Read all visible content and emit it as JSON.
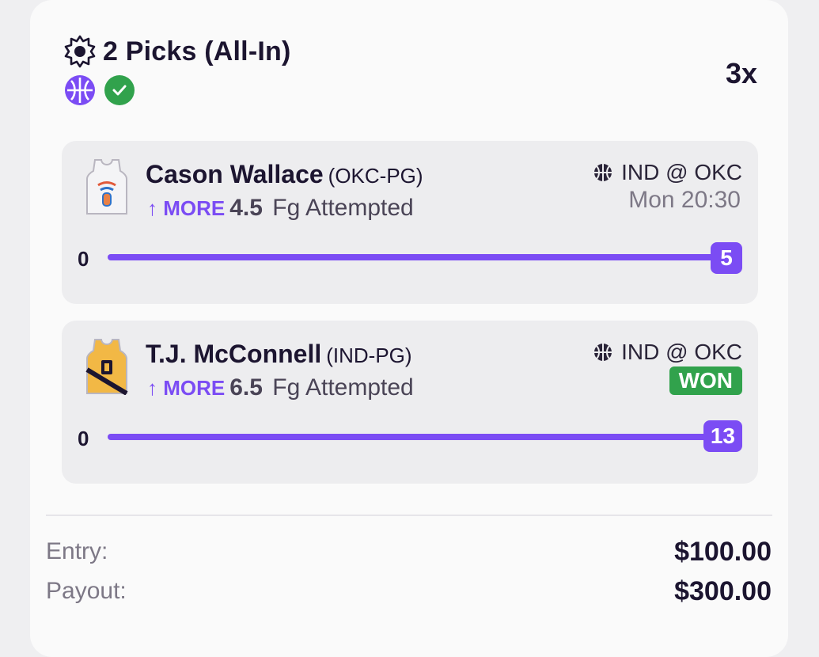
{
  "header": {
    "title": "2 Picks (All-In)",
    "multiplier": "3x",
    "icons": [
      "gear-icon",
      "basketball-icon",
      "check-icon"
    ],
    "accent_color": "#7b4cf4",
    "success_color": "#31a24c"
  },
  "picks": [
    {
      "player_name": "Cason Wallace",
      "team_pos": "(OKC-PG)",
      "direction": "↑ MORE",
      "line": "4.5",
      "stat": "Fg Attempted",
      "matchup": "IND @ OKC",
      "status": "Mon 20:30",
      "progress_start": "0",
      "progress_value": "5",
      "progress_fraction": 1.0,
      "jersey_icon": "okc-jersey-icon"
    },
    {
      "player_name": "T.J. McConnell",
      "team_pos": "(IND-PG)",
      "direction": "↑ MORE",
      "line": "6.5",
      "stat": "Fg Attempted",
      "matchup": "IND @ OKC",
      "status": "WON",
      "progress_start": "0",
      "progress_value": "13",
      "progress_fraction": 1.0,
      "jersey_icon": "ind-jersey-icon"
    }
  ],
  "footer": {
    "entry_label": "Entry:",
    "entry_value": "$100.00",
    "payout_label": "Payout:",
    "payout_value": "$300.00"
  }
}
